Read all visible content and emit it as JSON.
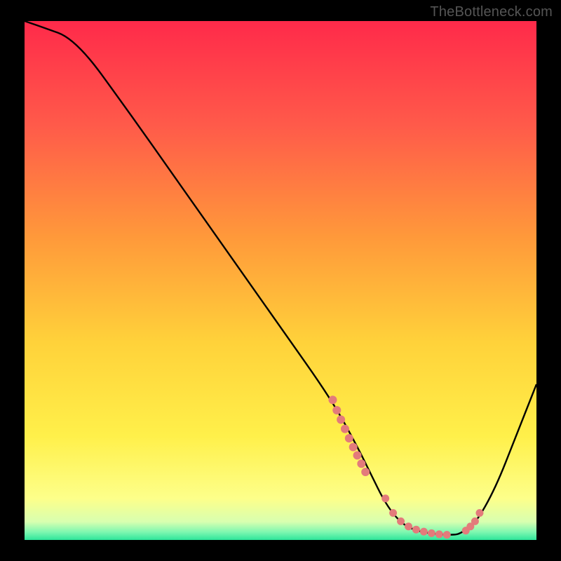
{
  "watermark": "TheBottleneck.com",
  "chart_data": {
    "type": "line",
    "title": "",
    "xlabel": "",
    "ylabel": "",
    "xlim": [
      0,
      100
    ],
    "ylim": [
      0,
      100
    ],
    "x": [
      0,
      3,
      10,
      20,
      30,
      40,
      50,
      60,
      65,
      68,
      70,
      72,
      74,
      76,
      78,
      80,
      82,
      84,
      85,
      88,
      92,
      96,
      100
    ],
    "y": [
      100,
      99,
      96.5,
      83,
      69,
      55,
      41,
      27,
      18,
      12,
      8,
      5,
      3,
      2,
      1.5,
      1.2,
      1,
      1,
      1.2,
      3,
      10,
      20,
      30
    ],
    "series": [
      {
        "name": "bottleneck-curve",
        "color": "#000000",
        "stroke_width": 2.4
      }
    ],
    "dot_clusters": [
      {
        "name": "left-slope-dots",
        "color": "#e37b7b",
        "size": 6,
        "points": [
          [
            60.2,
            27.0
          ],
          [
            61.0,
            25.0
          ],
          [
            61.8,
            23.2
          ],
          [
            62.6,
            21.4
          ],
          [
            63.4,
            19.6
          ],
          [
            64.2,
            17.9
          ],
          [
            65.0,
            16.3
          ],
          [
            65.8,
            14.7
          ],
          [
            66.6,
            13.1
          ]
        ]
      },
      {
        "name": "valley-floor-dots",
        "color": "#e37b7b",
        "size": 5.5,
        "points": [
          [
            70.5,
            8.0
          ],
          [
            72.0,
            5.2
          ],
          [
            73.5,
            3.6
          ],
          [
            75.0,
            2.6
          ],
          [
            76.5,
            2.0
          ],
          [
            78.0,
            1.6
          ],
          [
            79.5,
            1.3
          ],
          [
            81.0,
            1.1
          ],
          [
            82.5,
            1.0
          ]
        ]
      },
      {
        "name": "right-slope-dots",
        "color": "#e37b7b",
        "size": 5.5,
        "points": [
          [
            86.2,
            1.8
          ],
          [
            87.1,
            2.6
          ],
          [
            88.0,
            3.6
          ],
          [
            88.9,
            5.2
          ]
        ]
      }
    ],
    "background_gradient": {
      "type": "vertical",
      "stops": [
        {
          "offset": 0.0,
          "color": "#ff2a4a"
        },
        {
          "offset": 0.2,
          "color": "#ff5a4a"
        },
        {
          "offset": 0.42,
          "color": "#ff9a3a"
        },
        {
          "offset": 0.62,
          "color": "#ffd23a"
        },
        {
          "offset": 0.8,
          "color": "#fff04a"
        },
        {
          "offset": 0.92,
          "color": "#fdff8a"
        },
        {
          "offset": 0.965,
          "color": "#d8ffb0"
        },
        {
          "offset": 0.985,
          "color": "#7cf7b0"
        },
        {
          "offset": 1.0,
          "color": "#2de59a"
        }
      ]
    }
  }
}
